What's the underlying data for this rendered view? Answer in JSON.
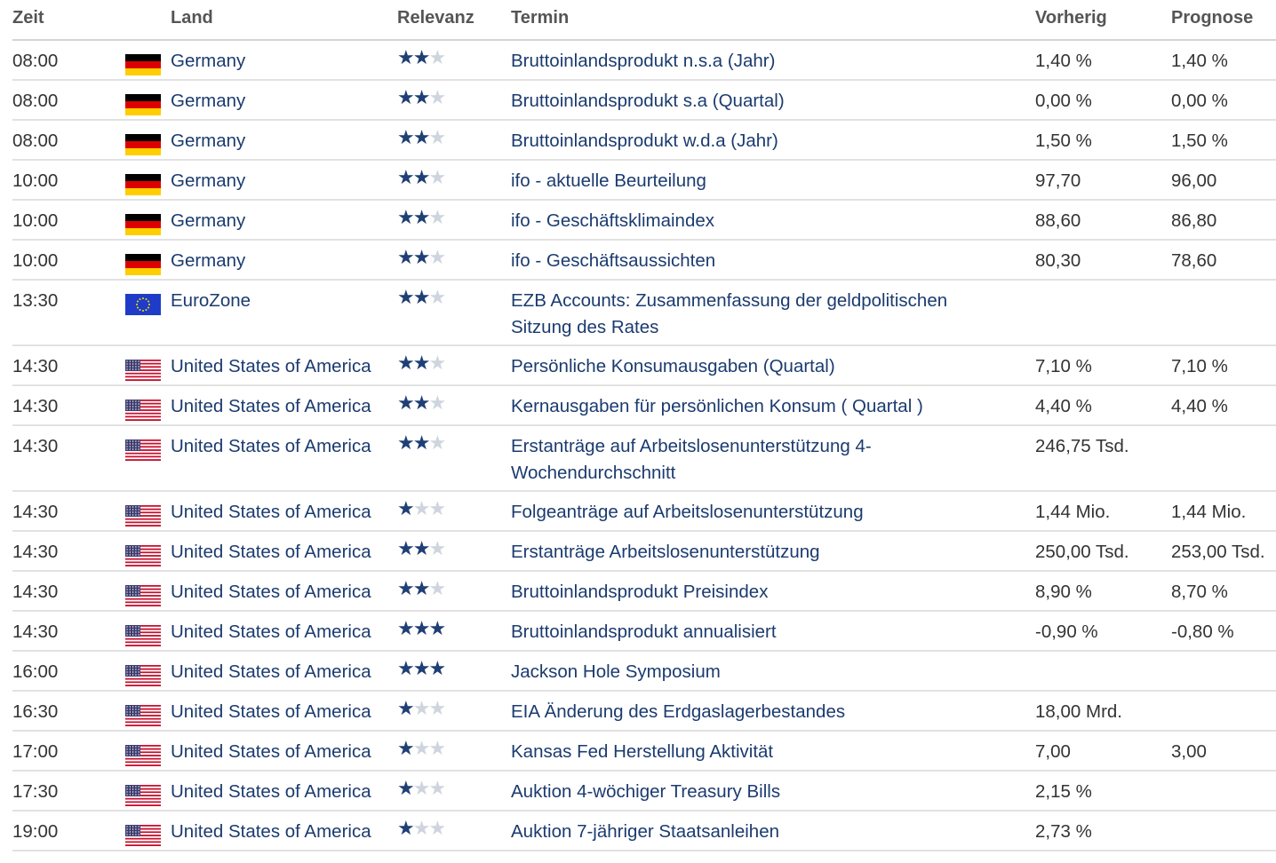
{
  "header": {
    "zeit": "Zeit",
    "land": "Land",
    "relevanz": "Relevanz",
    "termin": "Termin",
    "vorherig": "Vorherig",
    "prognose": "Prognose"
  },
  "colors": {
    "link": "#1b3b6f",
    "star_on": "#1f3f75",
    "star_off": "#cfd5de"
  },
  "rows": [
    {
      "time": "08:00",
      "flag": "de",
      "country": "Germany",
      "stars": 2,
      "event": "Bruttoinlandsprodukt n.s.a (Jahr)",
      "prev": "1,40 %",
      "forecast": "1,40 %",
      "tall": false
    },
    {
      "time": "08:00",
      "flag": "de",
      "country": "Germany",
      "stars": 2,
      "event": "Bruttoinlandsprodukt s.a (Quartal)",
      "prev": "0,00 %",
      "forecast": "0,00 %",
      "tall": false
    },
    {
      "time": "08:00",
      "flag": "de",
      "country": "Germany",
      "stars": 2,
      "event": "Bruttoinlandsprodukt w.d.a (Jahr)",
      "prev": "1,50 %",
      "forecast": "1,50 %",
      "tall": false
    },
    {
      "time": "10:00",
      "flag": "de",
      "country": "Germany",
      "stars": 2,
      "event": "ifo - aktuelle Beurteilung",
      "prev": "97,70",
      "forecast": "96,00",
      "tall": false
    },
    {
      "time": "10:00",
      "flag": "de",
      "country": "Germany",
      "stars": 2,
      "event": "ifo - Geschäftsklimaindex",
      "prev": "88,60",
      "forecast": "86,80",
      "tall": false
    },
    {
      "time": "10:00",
      "flag": "de",
      "country": "Germany",
      "stars": 2,
      "event": "ifo - Geschäftsaussichten",
      "prev": "80,30",
      "forecast": "78,60",
      "tall": false
    },
    {
      "time": "13:30",
      "flag": "eu",
      "country": "EuroZone",
      "stars": 2,
      "event": "EZB Accounts: Zusammenfassung der geldpolitischen Sitzung des Rates",
      "prev": "",
      "forecast": "",
      "tall": true
    },
    {
      "time": "14:30",
      "flag": "us",
      "country": "United States of America",
      "stars": 2,
      "event": "Persönliche Konsumausgaben (Quartal)",
      "prev": "7,10 %",
      "forecast": "7,10 %",
      "tall": false
    },
    {
      "time": "14:30",
      "flag": "us",
      "country": "United States of America",
      "stars": 2,
      "event": "Kernausgaben für persönlichen Konsum ( Quartal )",
      "prev": "4,40 %",
      "forecast": "4,40 %",
      "tall": false
    },
    {
      "time": "14:30",
      "flag": "us",
      "country": "United States of America",
      "stars": 2,
      "event": "Erstanträge auf Arbeitslosenunterstützung 4-Wochendurchschnitt",
      "prev": "246,75 Tsd.",
      "forecast": "",
      "tall": true
    },
    {
      "time": "14:30",
      "flag": "us",
      "country": "United States of America",
      "stars": 1,
      "event": "Folgeanträge auf Arbeitslosenunterstützung",
      "prev": "1,44 Mio.",
      "forecast": "1,44 Mio.",
      "tall": false
    },
    {
      "time": "14:30",
      "flag": "us",
      "country": "United States of America",
      "stars": 2,
      "event": "Erstanträge Arbeitslosenunterstützung",
      "prev": "250,00 Tsd.",
      "forecast": "253,00 Tsd.",
      "tall": false
    },
    {
      "time": "14:30",
      "flag": "us",
      "country": "United States of America",
      "stars": 2,
      "event": "Bruttoinlandsprodukt Preisindex",
      "prev": "8,90 %",
      "forecast": "8,70 %",
      "tall": false
    },
    {
      "time": "14:30",
      "flag": "us",
      "country": "United States of America",
      "stars": 3,
      "event": "Bruttoinlandsprodukt annualisiert",
      "prev": "-0,90 %",
      "forecast": "-0,80 %",
      "tall": false
    },
    {
      "time": "16:00",
      "flag": "us",
      "country": "United States of America",
      "stars": 3,
      "event": "Jackson Hole Symposium",
      "prev": "",
      "forecast": "",
      "tall": false
    },
    {
      "time": "16:30",
      "flag": "us",
      "country": "United States of America",
      "stars": 1,
      "event": "EIA Änderung des Erdgaslagerbestandes",
      "prev": "18,00 Mrd.",
      "forecast": "",
      "tall": false
    },
    {
      "time": "17:00",
      "flag": "us",
      "country": "United States of America",
      "stars": 1,
      "event": "Kansas Fed Herstellung Aktivität",
      "prev": "7,00",
      "forecast": "3,00",
      "tall": false
    },
    {
      "time": "17:30",
      "flag": "us",
      "country": "United States of America",
      "stars": 1,
      "event": "Auktion 4-wöchiger Treasury Bills",
      "prev": "2,15 %",
      "forecast": "",
      "tall": false
    },
    {
      "time": "19:00",
      "flag": "us",
      "country": "United States of America",
      "stars": 1,
      "event": "Auktion 7-jähriger Staatsanleihen",
      "prev": "2,73 %",
      "forecast": "",
      "tall": false
    }
  ]
}
